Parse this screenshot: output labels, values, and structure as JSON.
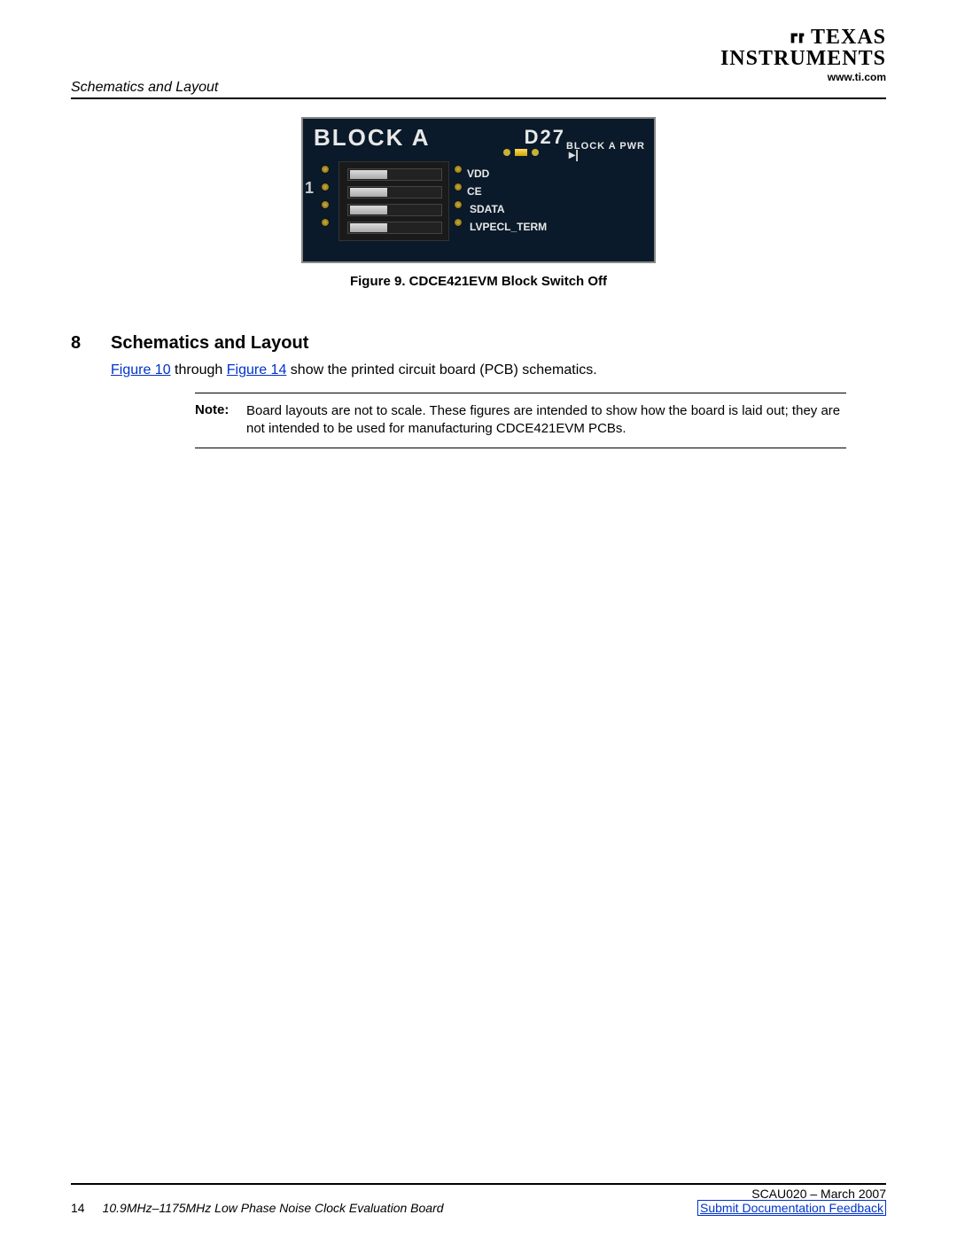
{
  "header": {
    "logo_line1": "TEXAS",
    "logo_line2": "INSTRUMENTS",
    "url": "www.ti.com",
    "section_title": "Schematics and Layout"
  },
  "pcb_labels": {
    "block_a": "BLOCK  A",
    "d27": "D27",
    "block_a_pwr": "BLOCK A PWR",
    "one": "1",
    "vdd": "VDD",
    "ce": "CE",
    "sdata": "SDATA",
    "lvpecl": "LVPECL_TERM",
    "diode": "▸|"
  },
  "figure": {
    "caption": "Figure 9. CDCE421EVM Block Switch Off"
  },
  "section": {
    "number": "8",
    "title": "Schematics and Layout",
    "body_pre": "",
    "link1": "Figure 10",
    "body_mid": " through ",
    "link2": "Figure 14",
    "body_post": " show the printed circuit board (PCB) schematics."
  },
  "note": {
    "label": "Note:",
    "text": "Board layouts are not to scale. These figures are intended to show how the board is laid out; they are not intended to be used for manufacturing CDCE421EVM PCBs."
  },
  "footer": {
    "page": "14",
    "title": "10.9MHz–1175MHz Low Phase Noise Clock Evaluation Board",
    "docid": "SCAU020 – March 2007",
    "feedback": "Submit Documentation Feedback"
  }
}
